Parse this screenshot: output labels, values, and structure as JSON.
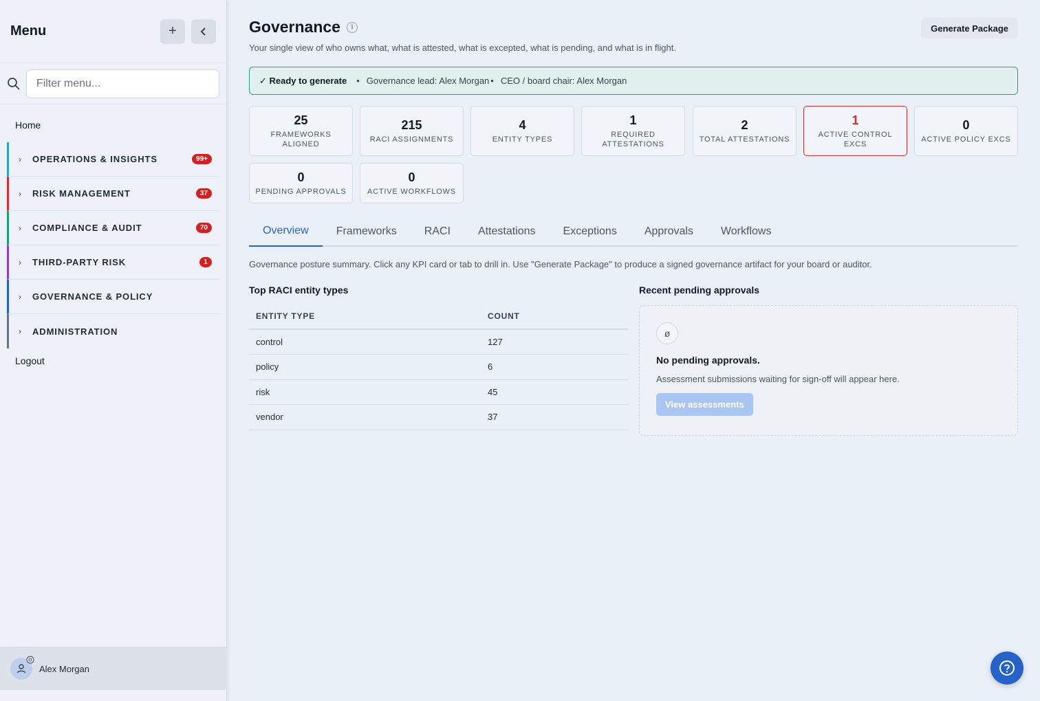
{
  "sidebar": {
    "title": "Menu",
    "add_icon": "plus-icon",
    "collapse_icon": "chevron-left-icon",
    "filter_placeholder": "Filter menu...",
    "home": "Home",
    "groups": [
      {
        "label": "OPERATIONS & INSIGHTS",
        "badge": "99+",
        "color": "#2aa3c9"
      },
      {
        "label": "RISK MANAGEMENT",
        "badge": "37",
        "color": "#d32f2f"
      },
      {
        "label": "COMPLIANCE & AUDIT",
        "badge": "70",
        "color": "#1f9d6e"
      },
      {
        "label": "THIRD-PARTY RISK",
        "badge": "1",
        "color": "#8b3fd1"
      },
      {
        "label": "GOVERNANCE & POLICY",
        "badge": "",
        "color": "#2563c9"
      },
      {
        "label": "ADMINISTRATION",
        "badge": "",
        "color": "#6b7280"
      }
    ],
    "logout": "Logout",
    "user_name": "Alex Morgan"
  },
  "header": {
    "title": "Governance",
    "subtitle": "Your single view of who owns what, what is attested, what is excepted, what is pending, and what is in flight.",
    "generate_label": "Generate Package"
  },
  "status": {
    "ready": "✓ Ready to generate",
    "lead": "Governance lead: Alex Morgan",
    "chair": "CEO / board chair: Alex Morgan"
  },
  "kpis": [
    {
      "value": "25",
      "label": "FRAMEWORKS ALIGNED"
    },
    {
      "value": "215",
      "label": "RACI ASSIGNMENTS"
    },
    {
      "value": "4",
      "label": "ENTITY TYPES"
    },
    {
      "value": "1",
      "label": "REQUIRED ATTESTATIONS"
    },
    {
      "value": "2",
      "label": "TOTAL ATTESTATIONS"
    },
    {
      "value": "1",
      "label": "ACTIVE CONTROL EXCS"
    },
    {
      "value": "0",
      "label": "ACTIVE POLICY EXCS"
    },
    {
      "value": "0",
      "label": "PENDING APPROVALS"
    },
    {
      "value": "0",
      "label": "ACTIVE WORKFLOWS"
    }
  ],
  "tabs": [
    "Overview",
    "Frameworks",
    "RACI",
    "Attestations",
    "Exceptions",
    "Approvals",
    "Workflows"
  ],
  "summary": "Governance posture summary. Click any KPI card or tab to drill in. Use \"Generate Package\" to produce a signed governance artifact for your board or auditor.",
  "raci": {
    "title": "Top RACI entity types",
    "columns": [
      "ENTITY TYPE",
      "COUNT"
    ],
    "rows": [
      [
        "control",
        "127"
      ],
      [
        "policy",
        "6"
      ],
      [
        "risk",
        "45"
      ],
      [
        "vendor",
        "37"
      ]
    ]
  },
  "approvals": {
    "title": "Recent pending approvals",
    "empty_icon": "ø",
    "empty_title": "No pending approvals.",
    "empty_desc": "Assessment submissions waiting for sign-off will appear here.",
    "button": "View assessments"
  },
  "colors": {
    "accent": "#2563c9",
    "danger": "#d32f2f",
    "success": "#2f9e74"
  }
}
